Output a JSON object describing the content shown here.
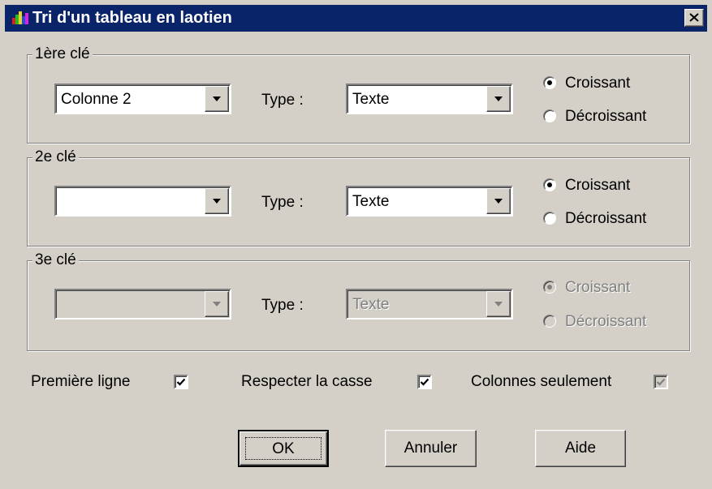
{
  "window": {
    "title": "Tri d'un tableau en laotien",
    "app_icon": "multicolor-app-icon",
    "close_icon": "close-icon"
  },
  "keys": [
    {
      "legend": "1ère clé",
      "column_value": "Colonne 2",
      "type_label": "Type :",
      "type_value": "Texte",
      "ascending_label": "Croissant",
      "descending_label": "Décroissant",
      "ascending_selected": true,
      "enabled": true
    },
    {
      "legend": "2e clé",
      "column_value": "",
      "type_label": "Type :",
      "type_value": "Texte",
      "ascending_label": "Croissant",
      "descending_label": "Décroissant",
      "ascending_selected": true,
      "enabled": true
    },
    {
      "legend": "3e clé",
      "column_value": "",
      "type_label": "Type :",
      "type_value": "Texte",
      "ascending_label": "Croissant",
      "descending_label": "Décroissant",
      "ascending_selected": true,
      "enabled": false
    }
  ],
  "options": {
    "first_row_label": "Première ligne",
    "first_row_checked": true,
    "match_case_label": "Respecter la casse",
    "match_case_checked": true,
    "columns_only_label": "Colonnes seulement",
    "columns_only_checked": true,
    "columns_only_enabled": false
  },
  "buttons": {
    "ok": "OK",
    "cancel": "Annuler",
    "help": "Aide"
  },
  "colors": {
    "dialog_bg": "#d4d0c8",
    "title_bar": "#0a246a",
    "disabled_text": "#808080"
  }
}
